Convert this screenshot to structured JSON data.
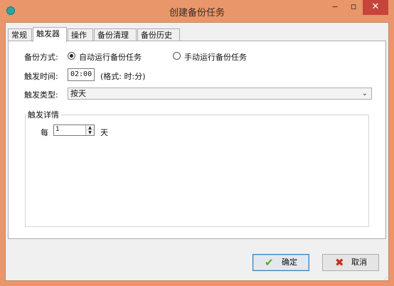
{
  "window": {
    "title": "创建备份任务",
    "minimize_glyph": "‒",
    "maximize_glyph": "▫",
    "close_glyph": "✕",
    "icons": [
      "app-icon",
      "minimize-icon",
      "maximize-icon",
      "close-icon"
    ]
  },
  "tabs": [
    {
      "label": "常规",
      "active": false
    },
    {
      "label": "触发器",
      "active": true
    },
    {
      "label": "操作",
      "active": false
    },
    {
      "label": "备份清理",
      "active": false
    },
    {
      "label": "备份历史",
      "active": false
    }
  ],
  "trigger": {
    "mode_label": "备份方式:",
    "mode_options": [
      {
        "label": "自动运行备份任务",
        "checked": true
      },
      {
        "label": "手动运行备份任务",
        "checked": false
      }
    ],
    "time_label": "触发时间:",
    "time_value": "02:00",
    "time_hint": "(格式: 时:分)",
    "type_label": "触发类型:",
    "type_selected": "按天",
    "type_chevron": "⌄",
    "details_legend": "触发详情",
    "every_label": "每",
    "every_value": "1",
    "spin_up": "▲",
    "spin_down": "▼",
    "unit_label": "天"
  },
  "buttons": {
    "ok_label": "确定",
    "ok_icon": "✔",
    "cancel_label": "取消",
    "cancel_icon": "✖"
  },
  "colors": {
    "title_bar": "#e9966a",
    "close_button": "#c7443b",
    "ok_check": "#5aa820",
    "cancel_x": "#d02a1a"
  }
}
